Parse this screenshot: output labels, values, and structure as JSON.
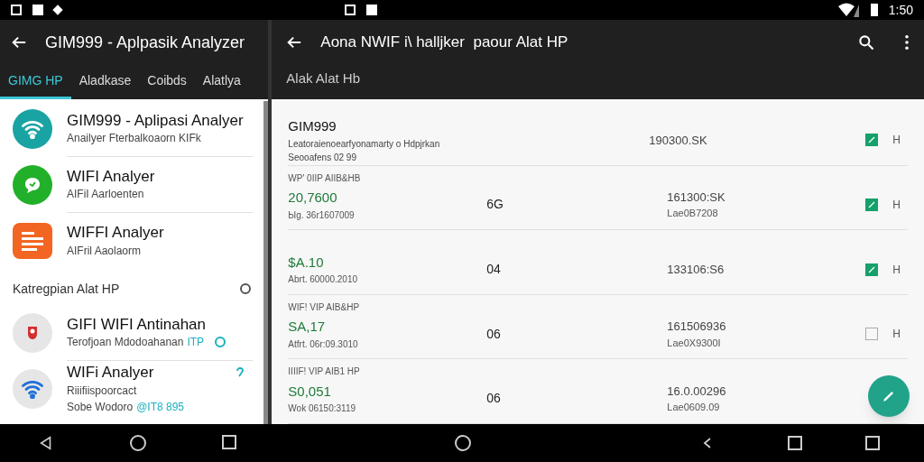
{
  "status_bar": {
    "time": "1:50"
  },
  "left_pane": {
    "title": "GIM999 - Aplpasik Analyzer",
    "tabs": [
      {
        "label": "GIMG HP",
        "selected": true
      },
      {
        "label": "Aladkase",
        "selected": false
      },
      {
        "label": "Coibds",
        "selected": false
      },
      {
        "label": "Alatlya",
        "selected": false
      }
    ],
    "apps": [
      {
        "kind": "wifi",
        "title": "GIM999 - Aplipasi Analyer",
        "subtitle": "Anailyer Fterbalkoaorn KIFk"
      },
      {
        "kind": "chat",
        "title": "WIFI Analyer",
        "subtitle": "AIFiI Aarloenten"
      },
      {
        "kind": "list",
        "title": "WIFFI Analyer",
        "subtitle": "AIFril Aaolaorm"
      }
    ],
    "section": {
      "label": "Katregpian Alat HP"
    },
    "category_apps": [
      {
        "kind": "bug",
        "title": "GIFI WIFI Antinahan",
        "subtitle": "Terofjoan Mdodoahanan",
        "accent": "ITP"
      },
      {
        "kind": "wifi",
        "title": "WIFi Analyer",
        "subtitle": "Riiifiispoorcact",
        "detail": "Sobe Wodoro",
        "accent": "@IT8 895"
      }
    ]
  },
  "right_pane": {
    "title": "Aona NWIF i\\ halljker  paour Alat HP",
    "subtitle": "Alak Alat Hb",
    "first": {
      "name": "GIM999",
      "line_1": "Leatoraienoearfyonamarty o Hdpjrkan",
      "line_2": "Seooafens 02 99",
      "value": "190300.SK",
      "checked": true,
      "tag": "H"
    },
    "rows": [
      {
        "section": "WP' 0IIP AIIB&HB",
        "amount": "20,7600",
        "amount_sub": "Ыg. 36r1607009",
        "count": "6G",
        "size": "161300:SK",
        "size_sub": "Lae0B7208",
        "checked": true,
        "tag": "H"
      },
      {
        "amount": "$A.10",
        "amount_sub": "Abrt. 60000.2010",
        "count": "04",
        "size": "133106:S6",
        "checked": true,
        "tag": "H"
      },
      {
        "section": "WIF! VIP AIB&HP",
        "amount": "SA,17",
        "amount_sub": "Atfrt. 06r:09.3010",
        "count": "06",
        "size": "161506936",
        "size_sub": "Lae0X9300I",
        "checked": false,
        "tag": "H"
      },
      {
        "section": "IIIIF! VIP AIB1 HP",
        "amount": "S0,051",
        "amount_sub": "Wok 06150:3119",
        "count": "06",
        "size": "16.0.00296",
        "size_sub": "Lae0609.09"
      }
    ]
  }
}
